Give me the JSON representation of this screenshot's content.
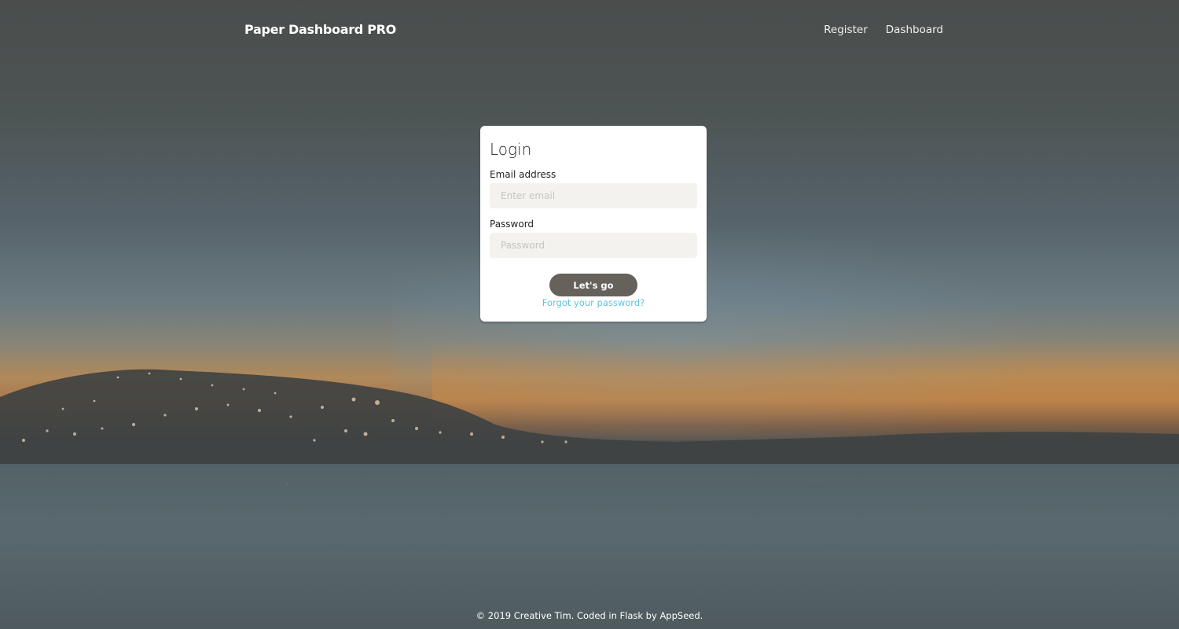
{
  "navbar": {
    "brand": "Paper Dashboard PRO",
    "links": [
      {
        "label": "Register"
      },
      {
        "label": "Dashboard"
      }
    ]
  },
  "login_card": {
    "title": "Login",
    "email_label": "Email address",
    "email_placeholder": "Enter email",
    "email_value": "",
    "password_label": "Password",
    "password_placeholder": "Password",
    "password_value": "",
    "submit_label": "Let's go",
    "forgot_label": "Forgot your password?"
  },
  "footer": {
    "text": "© 2019 Creative Tim. Coded in Flask by AppSeed."
  },
  "colors": {
    "button": "#66615b",
    "link": "#51bcda",
    "input_bg": "#f3f2ee"
  }
}
